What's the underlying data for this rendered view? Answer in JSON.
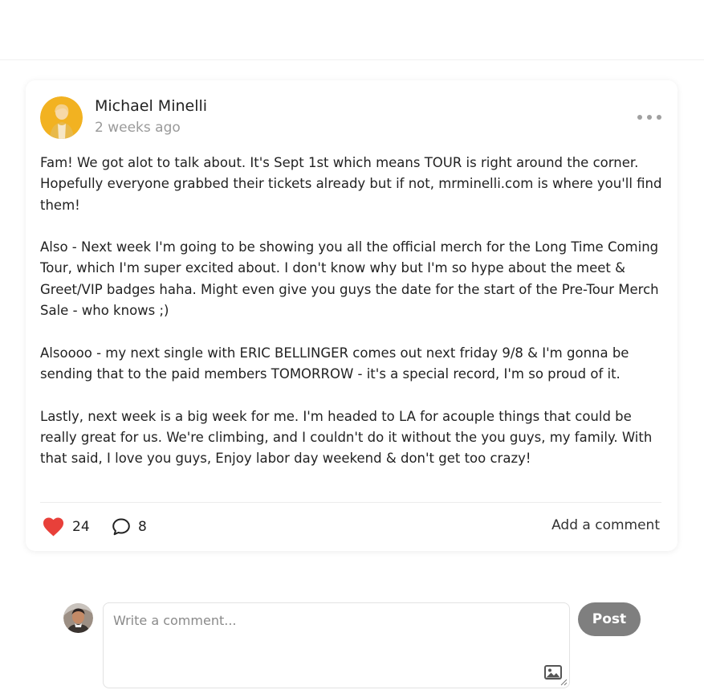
{
  "post": {
    "author": "Michael Minelli",
    "time": "2 weeks ago",
    "paragraphs": [
      "Fam! We got alot to talk about. It's Sept 1st which means TOUR is right around the corner. Hopefully everyone grabbed their tickets already but if not, mrminelli.com is where you'll find them!",
      "Also - Next week I'm going to be showing you all the official merch for the Long Time Coming Tour, which I'm super excited about. I don't know why but I'm so hype about the meet & Greet/VIP badges haha. Might even give you guys the date for the start of the Pre-Tour Merch Sale - who knows ;)",
      "Alsoooo - my next single with ERIC BELLINGER comes out next friday 9/8 & I'm gonna be sending that to the paid members TOMORROW - it's a special record, I'm so proud of it.",
      "Lastly, next week is a big week for me. I'm headed to LA for acouple things that could be really great for us. We're climbing, and I couldn't do it without the you guys, my family. With that said, I love you guys, Enjoy labor day weekend & don't get too crazy!"
    ],
    "likes": "24",
    "comments": "8",
    "add_comment_label": "Add a comment"
  },
  "composer": {
    "placeholder": "Write a comment...",
    "post_label": "Post"
  },
  "icons": {
    "more": "more-horizontal-icon",
    "like": "heart-icon",
    "comment": "comment-bubble-icon",
    "image": "image-icon"
  },
  "colors": {
    "heart": "#e8403a",
    "post_button": "#7f7f7f",
    "muted_text": "#9a9a9a"
  }
}
